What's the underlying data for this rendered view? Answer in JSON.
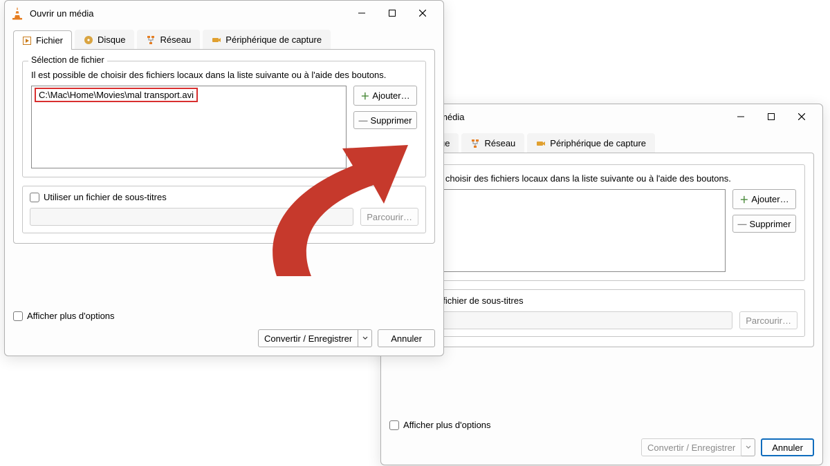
{
  "window_title": "Ouvrir un média",
  "tabs": {
    "file": "Fichier",
    "disc": "Disque",
    "network": "Réseau",
    "capture": "Périphérique de capture"
  },
  "file_panel": {
    "legend": "Sélection de fichier",
    "instruction": "Il est possible de choisir des fichiers locaux dans la liste suivante ou à l'aide des boutons.",
    "file_path": "C:\\Mac\\Home\\Movies\\mal transport.avi",
    "add_button": "Ajouter…",
    "remove_button": "Supprimer"
  },
  "subtitle": {
    "checkbox_label": "Utiliser un fichier de sous-titres",
    "browse_button": "Parcourir…"
  },
  "show_more": "Afficher plus d'options",
  "footer": {
    "convert": "Convertir / Enregistrer",
    "cancel": "Annuler"
  }
}
